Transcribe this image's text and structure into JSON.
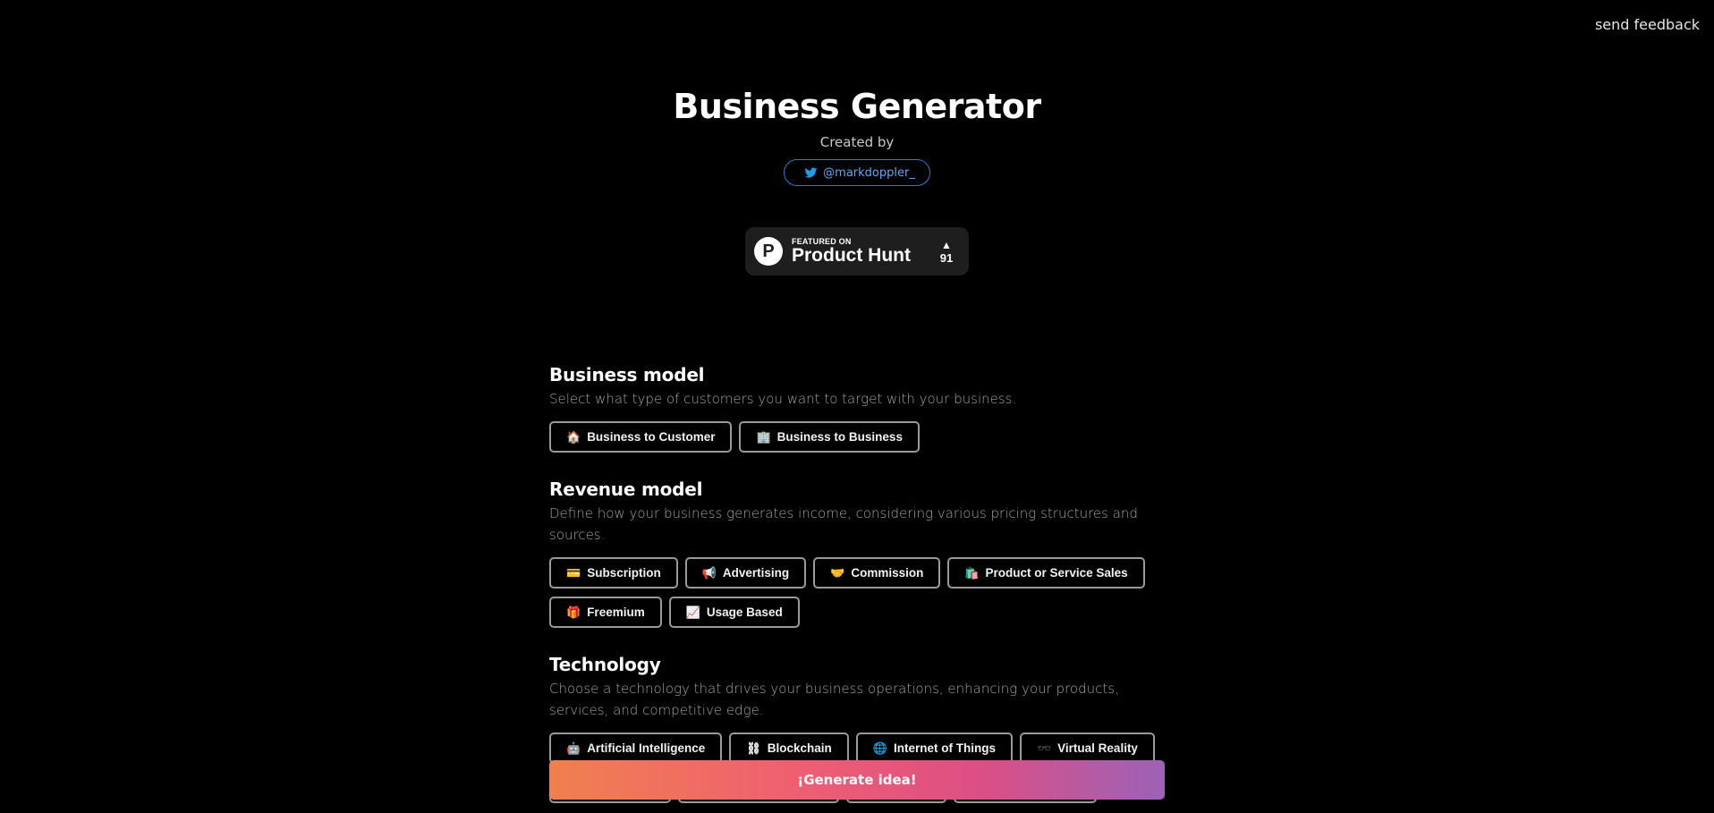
{
  "header": {
    "feedback_label": "send feedback"
  },
  "hero": {
    "title": "Business Generator",
    "created_by": "Created by",
    "twitter_handle": "@markdoppler_",
    "product_hunt": {
      "small": "FEATURED ON",
      "big": "Product Hunt",
      "votes": "91",
      "logo_letter": "P",
      "arrow": "▲"
    }
  },
  "sections": {
    "business_model": {
      "title": "Business model",
      "description": "Select what type of customers you want to target with your business.",
      "options": [
        {
          "icon": "🏠",
          "label": "Business to Customer"
        },
        {
          "icon": "🏢",
          "label": "Business to Business"
        }
      ]
    },
    "revenue_model": {
      "title": "Revenue model",
      "description": "Define how your business generates income, considering various pricing structures and sources.",
      "options": [
        {
          "icon": "💳",
          "label": "Subscription"
        },
        {
          "icon": "📢",
          "label": "Advertising"
        },
        {
          "icon": "🤝",
          "label": "Commission"
        },
        {
          "icon": "🛍️",
          "label": "Product or Service Sales"
        },
        {
          "icon": "🎁",
          "label": "Freemium"
        },
        {
          "icon": "📈",
          "label": "Usage Based"
        }
      ]
    },
    "technology": {
      "title": "Technology",
      "description": "Choose a technology that drives your business operations, enhancing your products, services, and competitive edge.",
      "options": [
        {
          "icon": "🤖",
          "label": "Artificial Intelligence"
        },
        {
          "icon": "⛓",
          "label": "Blockchain"
        },
        {
          "icon": "🌐",
          "label": "Internet of Things"
        },
        {
          "icon": "🕶️",
          "label": "Virtual Reality"
        }
      ]
    }
  },
  "generate_label": "¡Generate idea!",
  "colors": {
    "twitter": "#1d9bf0",
    "gradient_start": "#f0804f",
    "gradient_end": "#9c62b8"
  }
}
